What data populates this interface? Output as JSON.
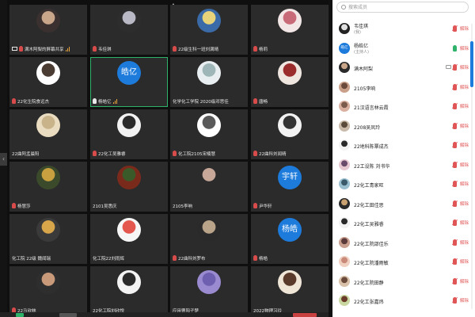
{
  "meeting": {
    "tiles": [
      {
        "name": "满木阿梨的屏幕共享",
        "avatar": "photo",
        "colors": [
          "#3a3030",
          "#c9a58a"
        ],
        "sharing": true,
        "signal": true
      },
      {
        "name": "韦佳琪",
        "avatar": "photo",
        "colors": [
          "#2d2d2d",
          "#b9b9c6"
        ],
        "sharing": false,
        "signal": false
      },
      {
        "name": "22级生科一班刘满晴",
        "avatar": "photo",
        "colors": [
          "#3a6aa8",
          "#e8d27a"
        ],
        "sharing": false,
        "signal": false
      },
      {
        "name": "杨莉",
        "avatar": "photo",
        "colors": [
          "#f3e6e6",
          "#c96a78"
        ],
        "sharing": false,
        "signal": false
      },
      {
        "name": "22化生院食远杰",
        "avatar": "photo",
        "colors": [
          "#ffffff",
          "#4a3b33"
        ],
        "sharing": false,
        "signal": false
      },
      {
        "name": "杨皓亿",
        "avatar": "text",
        "avatar_text": "皓亿",
        "colors": [
          "#1d7bdc",
          "#1d7bdc"
        ],
        "sharing": false,
        "signal": true,
        "mic_on": true,
        "active": true
      },
      {
        "name": "化学化工学院 2020级邓思佳",
        "avatar": "photo",
        "colors": [
          "#e9eef0",
          "#9fb6b8"
        ],
        "sharing": false,
        "signal": false,
        "no_mic": true
      },
      {
        "name": "唐畅",
        "avatar": "photo",
        "colors": [
          "#f0e6e0",
          "#9a2c2c"
        ],
        "sharing": false,
        "signal": false
      },
      {
        "name": "22曲阿孟晨阳",
        "avatar": "photo",
        "colors": [
          "#e9dcc0",
          "#c9b38a"
        ],
        "sharing": false,
        "signal": false,
        "no_mic": true
      },
      {
        "name": "22化工吴雅睿",
        "avatar": "photo",
        "colors": [
          "#f2f2f2",
          "#2a2a2a"
        ],
        "sharing": false,
        "signal": false
      },
      {
        "name": "化工院2105宋楠慧",
        "avatar": "photo",
        "colors": [
          "#ffffff",
          "#5a5a5a"
        ],
        "sharing": false,
        "signal": false
      },
      {
        "name": "22曲科刘闻晴",
        "avatar": "photo",
        "colors": [
          "#f2f2f2",
          "#333333"
        ],
        "sharing": false,
        "signal": false
      },
      {
        "name": "杨慧莎",
        "avatar": "photo",
        "colors": [
          "#3b4a2a",
          "#c9a040"
        ],
        "sharing": false,
        "signal": false
      },
      {
        "name": "2101吴悉庆",
        "avatar": "photo",
        "colors": [
          "#7a2a1a",
          "#3a5a2a"
        ],
        "sharing": false,
        "signal": false,
        "no_mic": true
      },
      {
        "name": "2105李响",
        "avatar": "photo",
        "colors": [
          "#2b2b2b",
          "#c7a898"
        ],
        "sharing": false,
        "signal": false,
        "bare": true
      },
      {
        "name": "尹华轩",
        "avatar": "text",
        "avatar_text": "宇轩",
        "colors": [
          "#1d7bdc",
          "#1d7bdc"
        ],
        "sharing": false,
        "signal": false
      },
      {
        "name": "化工院 22级 魏闻瑞",
        "avatar": "photo",
        "colors": [
          "#3a3a3a",
          "#d7a54a"
        ],
        "sharing": false,
        "signal": false,
        "no_mic": true
      },
      {
        "name": "化工院22刘雨辉",
        "avatar": "photo",
        "colors": [
          "#f6f6f6",
          "#e3574f"
        ],
        "sharing": false,
        "signal": false,
        "no_mic": true
      },
      {
        "name": "22曲科刘罗布",
        "avatar": "photo",
        "colors": [
          "#2a2a2a",
          "#b9a48a"
        ],
        "sharing": false,
        "signal": false
      },
      {
        "name": "杨皓",
        "avatar": "text",
        "avatar_text": "杨皓",
        "colors": [
          "#1d7bdc",
          "#1d7bdc"
        ],
        "sharing": false,
        "signal": false
      },
      {
        "name": "22马欣林",
        "avatar": "photo",
        "colors": [
          "#2e2e2e",
          "#c99a7a"
        ],
        "sharing": false,
        "signal": false
      },
      {
        "name": "22化工院刘欣悦",
        "avatar": "photo",
        "colors": [
          "#f3f3f3",
          "#2a2a2a"
        ],
        "sharing": false,
        "signal": false,
        "no_mic": true
      },
      {
        "name": "应用曹阳子楚",
        "avatar": "photo",
        "colors": [
          "#9a8ad0",
          "#6e5fb0"
        ],
        "sharing": false,
        "signal": false,
        "no_mic": true
      },
      {
        "name": "2022物理习玲",
        "avatar": "photo",
        "colors": [
          "#f0e6d8",
          "#5a3a2a"
        ],
        "sharing": false,
        "signal": false,
        "no_mic": true
      }
    ]
  },
  "panel": {
    "search_placeholder": "搜索成员",
    "mute_label": "解除",
    "participants": [
      {
        "name": "韦佳琪",
        "sub": "(我)",
        "avatar": "photo",
        "colors": [
          "#222222",
          "#e0e0e0"
        ],
        "cam": false,
        "mic": "off",
        "muted": true
      },
      {
        "name": "杨皓亿",
        "sub": "(主持人)",
        "avatar": "text",
        "avatar_text": "皓亿",
        "colors": [
          "#1d7bdc",
          "#1d7bdc"
        ],
        "cam": false,
        "mic": "on",
        "muted": true
      },
      {
        "name": "满木阿梨",
        "sub": "",
        "avatar": "photo",
        "colors": [
          "#2a2a2a",
          "#c9a58a"
        ],
        "cam": true,
        "mic": "off",
        "muted": true
      },
      {
        "name": "2105李响",
        "sub": "",
        "avatar": "photo",
        "colors": [
          "#caa08a",
          "#6a4a3a"
        ],
        "cam": false,
        "mic": "off",
        "muted": true
      },
      {
        "name": "21汉语言林云霞",
        "sub": "",
        "avatar": "photo",
        "colors": [
          "#d9b0a0",
          "#7a5a4a"
        ],
        "cam": false,
        "mic": "off",
        "muted": true
      },
      {
        "name": "2208吴凤玲",
        "sub": "",
        "avatar": "photo",
        "colors": [
          "#c9b9a8",
          "#5a4a3a"
        ],
        "cam": false,
        "mic": "off",
        "muted": true
      },
      {
        "name": "22地科陈覃成杰",
        "sub": "",
        "avatar": "photo",
        "colors": [
          "#f2f2f2",
          "#2a2a2a"
        ],
        "cam": false,
        "mic": "off",
        "muted": true
      },
      {
        "name": "22工设陈 刘书华",
        "sub": "",
        "avatar": "photo",
        "colors": [
          "#e8c8d0",
          "#6a4a6a"
        ],
        "cam": false,
        "mic": "off",
        "muted": true
      },
      {
        "name": "22化工青家旺",
        "sub": "",
        "avatar": "photo",
        "colors": [
          "#9ac0d0",
          "#3a5a6a"
        ],
        "cam": false,
        "mic": "off",
        "muted": true
      },
      {
        "name": "22化工田佳思",
        "sub": "",
        "avatar": "photo",
        "colors": [
          "#2a2a2a",
          "#c9a070"
        ],
        "cam": false,
        "mic": "off",
        "muted": true
      },
      {
        "name": "22化工吴雅睿",
        "sub": "",
        "avatar": "photo",
        "colors": [
          "#f2f2f2",
          "#2a2a2a"
        ],
        "cam": false,
        "mic": "off",
        "muted": true
      },
      {
        "name": "22化工院邵佳乐",
        "sub": "",
        "avatar": "photo",
        "colors": [
          "#c9a090",
          "#5a3a3a"
        ],
        "cam": false,
        "mic": "off",
        "muted": true
      },
      {
        "name": "22化工院潘雨敏",
        "sub": "",
        "avatar": "photo",
        "colors": [
          "#f0d0c0",
          "#c98a7a"
        ],
        "cam": false,
        "mic": "off",
        "muted": true
      },
      {
        "name": "22化工院田静",
        "sub": "",
        "avatar": "photo",
        "colors": [
          "#d9c0a8",
          "#6a4a3a"
        ],
        "cam": false,
        "mic": "off",
        "muted": true
      },
      {
        "name": "22化工张嘉炜",
        "sub": "",
        "avatar": "photo",
        "colors": [
          "#c9d8a0",
          "#6a3a2a"
        ],
        "cam": false,
        "mic": "off",
        "muted": true
      }
    ]
  },
  "colors": {
    "host_blue": "#1d7bdc",
    "active_green": "#2fb36b",
    "mute_red": "#e05555",
    "signal_orange": "#e6a23c"
  }
}
